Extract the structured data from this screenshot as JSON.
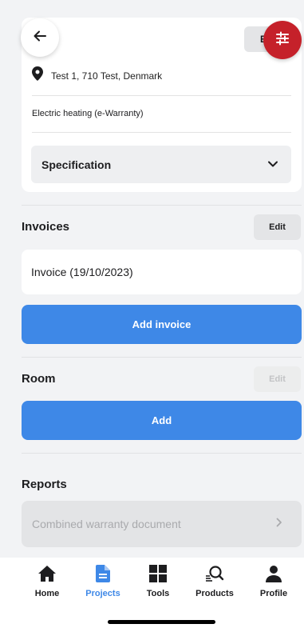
{
  "header": {
    "edit_label": "Edit",
    "back_icon": "back-arrow-icon",
    "filter_icon": "filter-icon",
    "accent": "#c5212a"
  },
  "details": {
    "address": "Test 1, 710 Test, Denmark",
    "product": "Electric heating (e-Warranty)",
    "specification_label": "Specification"
  },
  "invoices": {
    "title": "Invoices",
    "edit_label": "Edit",
    "items": [
      {
        "label": "Invoice (19/10/2023)"
      }
    ],
    "add_label": "Add invoice"
  },
  "room": {
    "title": "Room",
    "edit_label": "Edit",
    "add_label": "Add"
  },
  "reports": {
    "title": "Reports",
    "items": [
      {
        "label": "Combined warranty document"
      }
    ]
  },
  "nav": {
    "items": [
      {
        "label": "Home",
        "icon": "home-icon"
      },
      {
        "label": "Projects",
        "icon": "document-icon",
        "active": true
      },
      {
        "label": "Tools",
        "icon": "grid-icon"
      },
      {
        "label": "Products",
        "icon": "search-icon"
      },
      {
        "label": "Profile",
        "icon": "person-icon"
      }
    ]
  },
  "colors": {
    "primary": "#3e88e7",
    "background": "#f2f3f5"
  }
}
